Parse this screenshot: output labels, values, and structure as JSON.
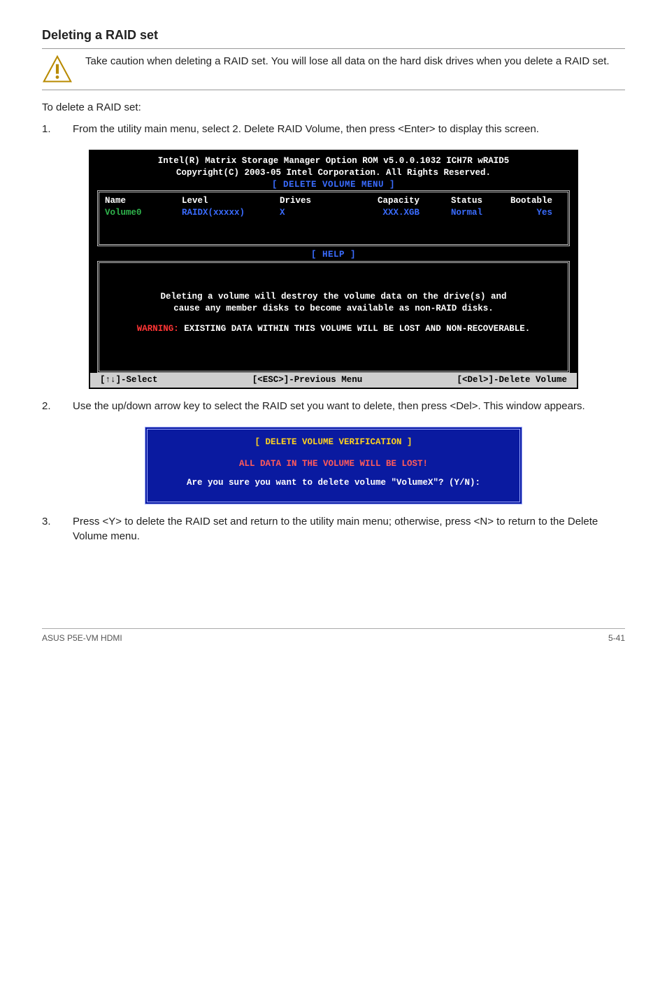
{
  "section_title": "Deleting a RAID set",
  "caution": "Take caution when deleting a RAID set. You will lose all data on the hard disk drives when you delete a RAID set.",
  "intro": "To delete a RAID set:",
  "steps": [
    "From the utility main menu, select 2. Delete RAID Volume, then press <Enter> to display this screen.",
    "Use the up/down arrow key to select the RAID set you want to delete, then press <Del>. This window appears.",
    "Press <Y> to delete the RAID set and return to the utility main menu; otherwise, press <N> to return to the Delete Volume menu."
  ],
  "bios_delete": {
    "title1": "Intel(R) Matrix Storage Manager Option ROM v5.0.0.1032 ICH7R wRAID5",
    "title2": "Copyright(C) 2003-05 Intel Corporation. All Rights Reserved.",
    "menu_label": "[ DELETE VOLUME MENU ]",
    "columns": [
      "Name",
      "Level",
      "Drives",
      "Capacity",
      "Status",
      "Bootable"
    ],
    "row": {
      "name": "Volume0",
      "level": "RAIDX(xxxxx)",
      "drives": "X",
      "capacity": "XXX.XGB",
      "status": "Normal",
      "bootable": "Yes"
    },
    "help_label": "[ HELP ]",
    "help1": "Deleting a volume will destroy the volume data on the drive(s) and",
    "help2": "cause any member disks to become available as non-RAID disks.",
    "warning_prefix": "WARNING:",
    "warning_body": " EXISTING DATA WITHIN THIS VOLUME WILL BE LOST AND NON-RECOVERABLE.",
    "status_left": "[↑↓]-Select",
    "status_mid": "[<ESC>]-Previous Menu",
    "status_right": "[<Del>]-Delete Volume"
  },
  "bios_verify": {
    "title": "[ DELETE VOLUME VERIFICATION ]",
    "line1": "ALL DATA IN THE VOLUME WILL BE LOST!",
    "line2": "Are you sure you want to delete volume \"VolumeX\"? (Y/N):"
  },
  "footer_left": "ASUS P5E-VM HDMI",
  "footer_right": "5-41"
}
